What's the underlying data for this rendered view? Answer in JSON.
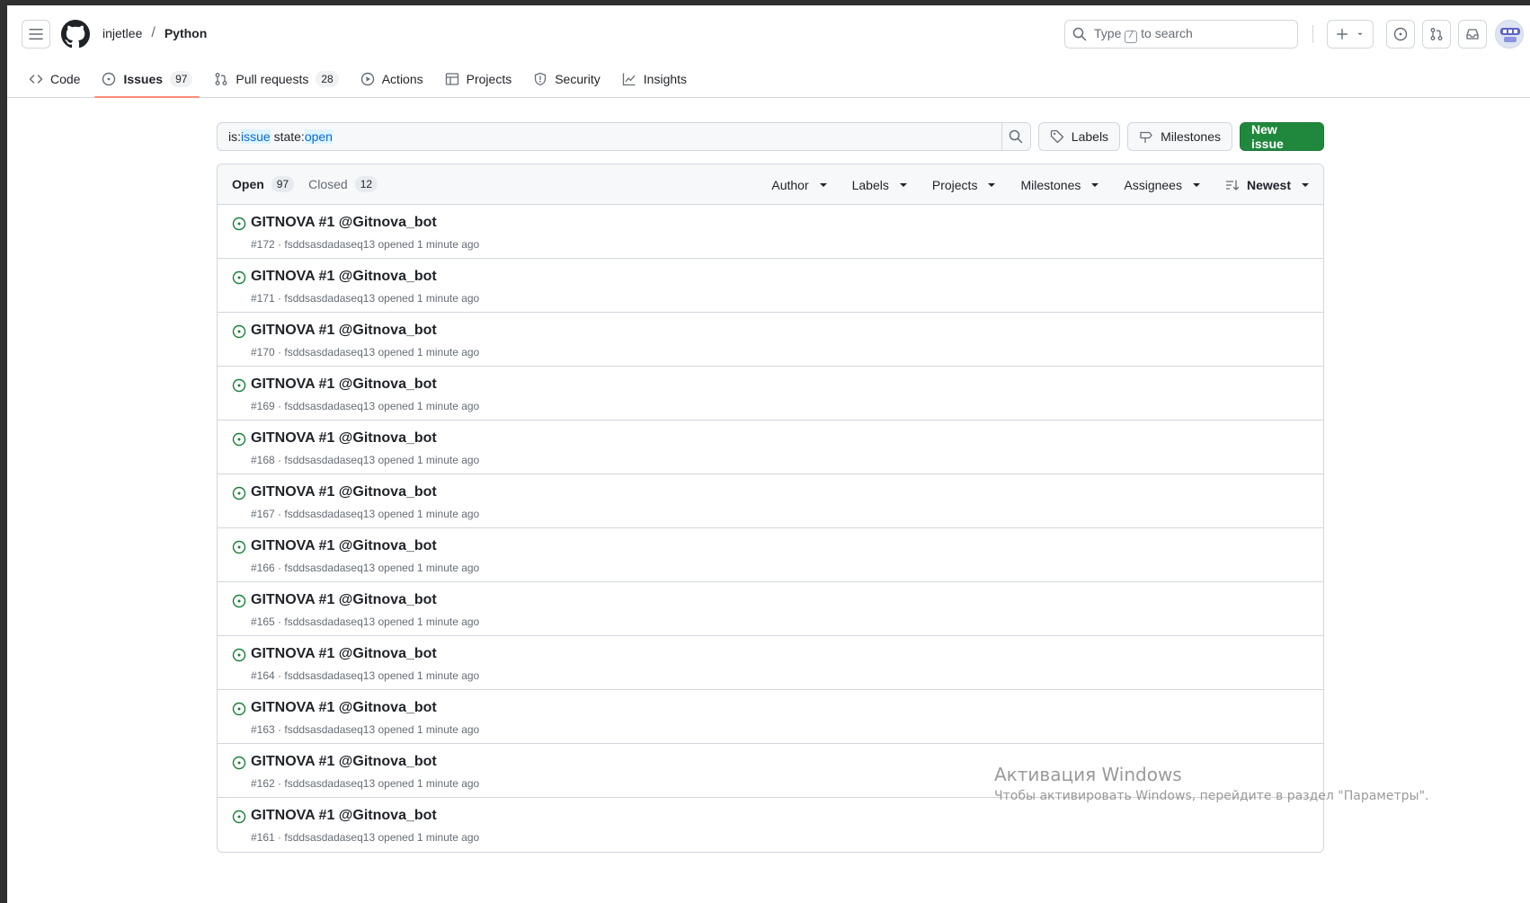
{
  "header": {
    "owner": "injetlee",
    "separator": "/",
    "repo": "Python",
    "search_prefix": "Type",
    "search_key": "/",
    "search_suffix": "to search"
  },
  "nav": {
    "tabs": [
      {
        "label": "Code",
        "icon": "code-icon"
      },
      {
        "label": "Issues",
        "icon": "issue-opened-icon",
        "count": "97",
        "active": true
      },
      {
        "label": "Pull requests",
        "icon": "git-pull-request-icon",
        "count": "28"
      },
      {
        "label": "Actions",
        "icon": "play-icon"
      },
      {
        "label": "Projects",
        "icon": "table-icon"
      },
      {
        "label": "Security",
        "icon": "shield-icon"
      },
      {
        "label": "Insights",
        "icon": "graph-icon"
      }
    ]
  },
  "filter_bar": {
    "query_is": "is:",
    "query_is_value": "issue",
    "query_state": " state:",
    "query_state_value": "open",
    "labels_button": "Labels",
    "milestones_button": "Milestones",
    "new_issue_button": "New issue"
  },
  "list_header": {
    "open_label": "Open",
    "open_count": "97",
    "closed_label": "Closed",
    "closed_count": "12",
    "filters": [
      "Author",
      "Labels",
      "Projects",
      "Milestones",
      "Assignees"
    ],
    "sort_label": "Newest"
  },
  "issues": [
    {
      "title": "GITNOVA #1 @Gitnova_bot",
      "number": "#172",
      "author": "fsddsasdadaseq13",
      "opened": "opened 1 minute ago"
    },
    {
      "title": "GITNOVA #1 @Gitnova_bot",
      "number": "#171",
      "author": "fsddsasdadaseq13",
      "opened": "opened 1 minute ago"
    },
    {
      "title": "GITNOVA #1 @Gitnova_bot",
      "number": "#170",
      "author": "fsddsasdadaseq13",
      "opened": "opened 1 minute ago"
    },
    {
      "title": "GITNOVA #1 @Gitnova_bot",
      "number": "#169",
      "author": "fsddsasdadaseq13",
      "opened": "opened 1 minute ago"
    },
    {
      "title": "GITNOVA #1 @Gitnova_bot",
      "number": "#168",
      "author": "fsddsasdadaseq13",
      "opened": "opened 1 minute ago"
    },
    {
      "title": "GITNOVA #1 @Gitnova_bot",
      "number": "#167",
      "author": "fsddsasdadaseq13",
      "opened": "opened 1 minute ago"
    },
    {
      "title": "GITNOVA #1 @Gitnova_bot",
      "number": "#166",
      "author": "fsddsasdadaseq13",
      "opened": "opened 1 minute ago"
    },
    {
      "title": "GITNOVA #1 @Gitnova_bot",
      "number": "#165",
      "author": "fsddsasdadaseq13",
      "opened": "opened 1 minute ago"
    },
    {
      "title": "GITNOVA #1 @Gitnova_bot",
      "number": "#164",
      "author": "fsddsasdadaseq13",
      "opened": "opened 1 minute ago"
    },
    {
      "title": "GITNOVA #1 @Gitnova_bot",
      "number": "#163",
      "author": "fsddsasdadaseq13",
      "opened": "opened 1 minute ago"
    },
    {
      "title": "GITNOVA #1 @Gitnova_bot",
      "number": "#162",
      "author": "fsddsasdadaseq13",
      "opened": "opened 1 minute ago"
    },
    {
      "title": "GITNOVA #1 @Gitnova_bot",
      "number": "#161",
      "author": "fsddsasdadaseq13",
      "opened": "opened 1 minute ago"
    }
  ],
  "watermark": {
    "title": "Активация Windows",
    "subtitle": "Чтобы активировать Windows, перейдите в раздел \"Параметры\"."
  },
  "colors": {
    "accent_green": "#1f883d",
    "open_issue": "#1a7f37",
    "active_tab_underline": "#fd8c73",
    "link_blue": "#0969da"
  }
}
